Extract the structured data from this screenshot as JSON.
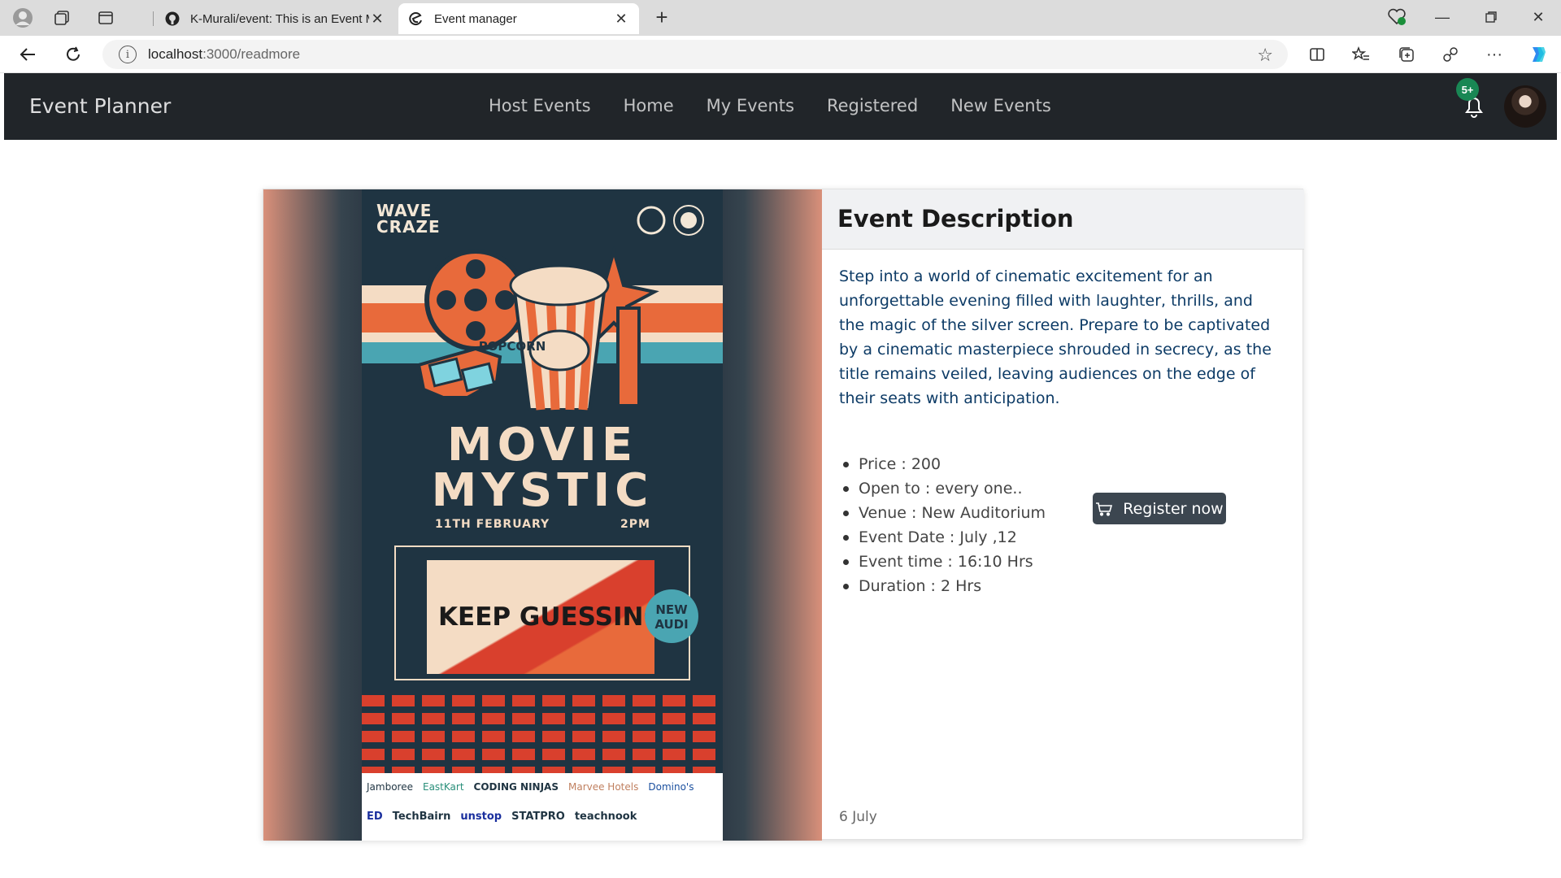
{
  "browser": {
    "tabs": [
      {
        "title": "K-Murali/event: This is an Event M",
        "favicon": "github-icon",
        "active": false
      },
      {
        "title": "Event manager",
        "favicon": "edge-icon",
        "active": true
      }
    ],
    "url_host": "localhost",
    "url_path": ":3000/readmore"
  },
  "navbar": {
    "brand": "Event Planner",
    "links": [
      "Host Events",
      "Home",
      "My Events",
      "Registered",
      "New Events"
    ],
    "notification_badge": "5+",
    "icons": {
      "notifications": "bell-icon",
      "profile": "avatar"
    }
  },
  "poster": {
    "logo_text": "WAVE CRAZE",
    "popcorn_label": "POPCORN",
    "title_line1": "MOVIE",
    "title_line2": "MYSTIC",
    "date": "11TH FEBRUARY",
    "time": "2PM",
    "tagline": "KEEP GUESSING..",
    "venue_badge_line1": "NEW",
    "venue_badge_line2": "AUDI",
    "sponsors_row1": [
      "Jamboree",
      "EastKart",
      "CODING NINJAS",
      "Marvee Hotels",
      "Domino's"
    ],
    "sponsors_row2": [
      "ED",
      "TechBairn",
      "unstop",
      "STATPRO",
      "teachnook"
    ]
  },
  "event": {
    "header": "Event Description",
    "description": "Step into a world of cinematic excitement for an unforgettable evening filled with laughter, thrills, and the magic of the silver screen. Prepare to be captivated by a cinematic masterpiece shrouded in secrecy, as the title remains veiled, leaving audiences on the edge of their seats with anticipation.",
    "details": [
      "Price : 200",
      "Open to : every one..",
      "Venue : New Auditorium",
      "Event Date : July ,12",
      "Event time : 16:10 Hrs",
      "Duration : 2 Hrs"
    ],
    "register_label": "Register now",
    "posted_date": "6 July"
  },
  "colors": {
    "navbar_bg": "#212529",
    "badge": "#198754",
    "register_btn": "#3c4650",
    "description_text": "#0d3b66"
  }
}
